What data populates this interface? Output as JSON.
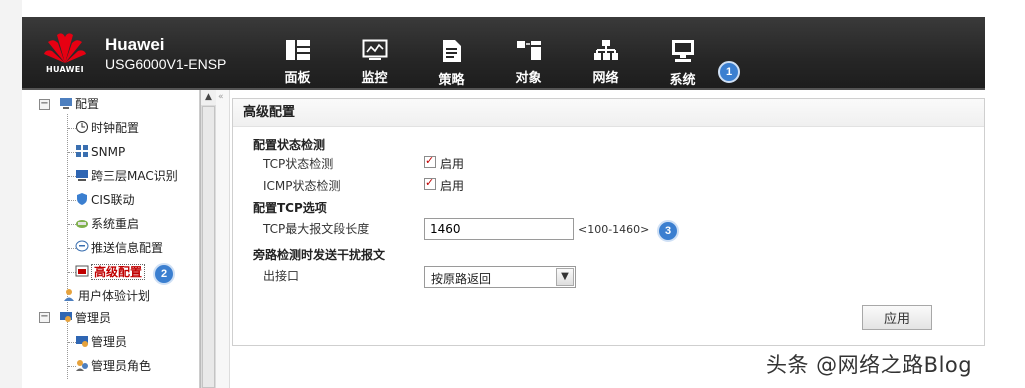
{
  "header": {
    "logo_text": "HUAWEI",
    "brand": "Huawei",
    "model": "USG6000V1-ENSP",
    "nav": [
      {
        "label": "面板",
        "icon": "dashboard-icon"
      },
      {
        "label": "监控",
        "icon": "monitor-chart-icon"
      },
      {
        "label": "策略",
        "icon": "policy-document-icon"
      },
      {
        "label": "对象",
        "icon": "object-icon"
      },
      {
        "label": "网络",
        "icon": "network-topology-icon"
      },
      {
        "label": "系统",
        "icon": "system-computer-icon"
      }
    ]
  },
  "badges": {
    "step1": "1",
    "step2": "2",
    "step3": "3"
  },
  "sidebar": {
    "root": {
      "label": "配置",
      "expander": "−",
      "icon": "config-icon"
    },
    "items": [
      {
        "label": "时钟配置",
        "icon": "clock-icon"
      },
      {
        "label": "SNMP",
        "icon": "snmp-icon"
      },
      {
        "label": "跨三层MAC识别",
        "icon": "computer-icon"
      },
      {
        "label": "CIS联动",
        "icon": "cis-shield-icon"
      },
      {
        "label": "系统重启",
        "icon": "restart-icon"
      },
      {
        "label": "推送信息配置",
        "icon": "message-icon"
      },
      {
        "label": "高级配置",
        "icon": "advanced-config-icon"
      }
    ],
    "user_plan": {
      "label": "用户体验计划",
      "icon": "user-experience-icon"
    },
    "admin": {
      "label": "管理员",
      "expander": "−",
      "icon": "admin-icon"
    },
    "admin_items": [
      {
        "label": "管理员",
        "icon": "admin-user-icon"
      },
      {
        "label": "管理员角色",
        "icon": "admin-role-icon"
      }
    ],
    "scroll_up": "▲",
    "collapse": "«"
  },
  "panel": {
    "title": "高级配置",
    "section1": "配置状态检测",
    "tcp_label": "TCP状态检测",
    "tcp_check_label": "启用",
    "icmp_label": "ICMP状态检测",
    "icmp_check_label": "启用",
    "section2": "配置TCP选项",
    "mss_label": "TCP最大报文段长度",
    "mss_value": "1460",
    "mss_hint": "<100-1460>",
    "section3": "旁路检测时发送干扰报文",
    "out_iface_label": "出接口",
    "out_iface_value": "按原路返回",
    "select_arrow": "▼",
    "apply": "应用"
  },
  "watermark": "头条 @网络之路Blog",
  "colors": {
    "header_bg": "#262626",
    "badge": "#3b7fd0",
    "selected_text": "#c00000",
    "logo_red": "#e60012"
  }
}
